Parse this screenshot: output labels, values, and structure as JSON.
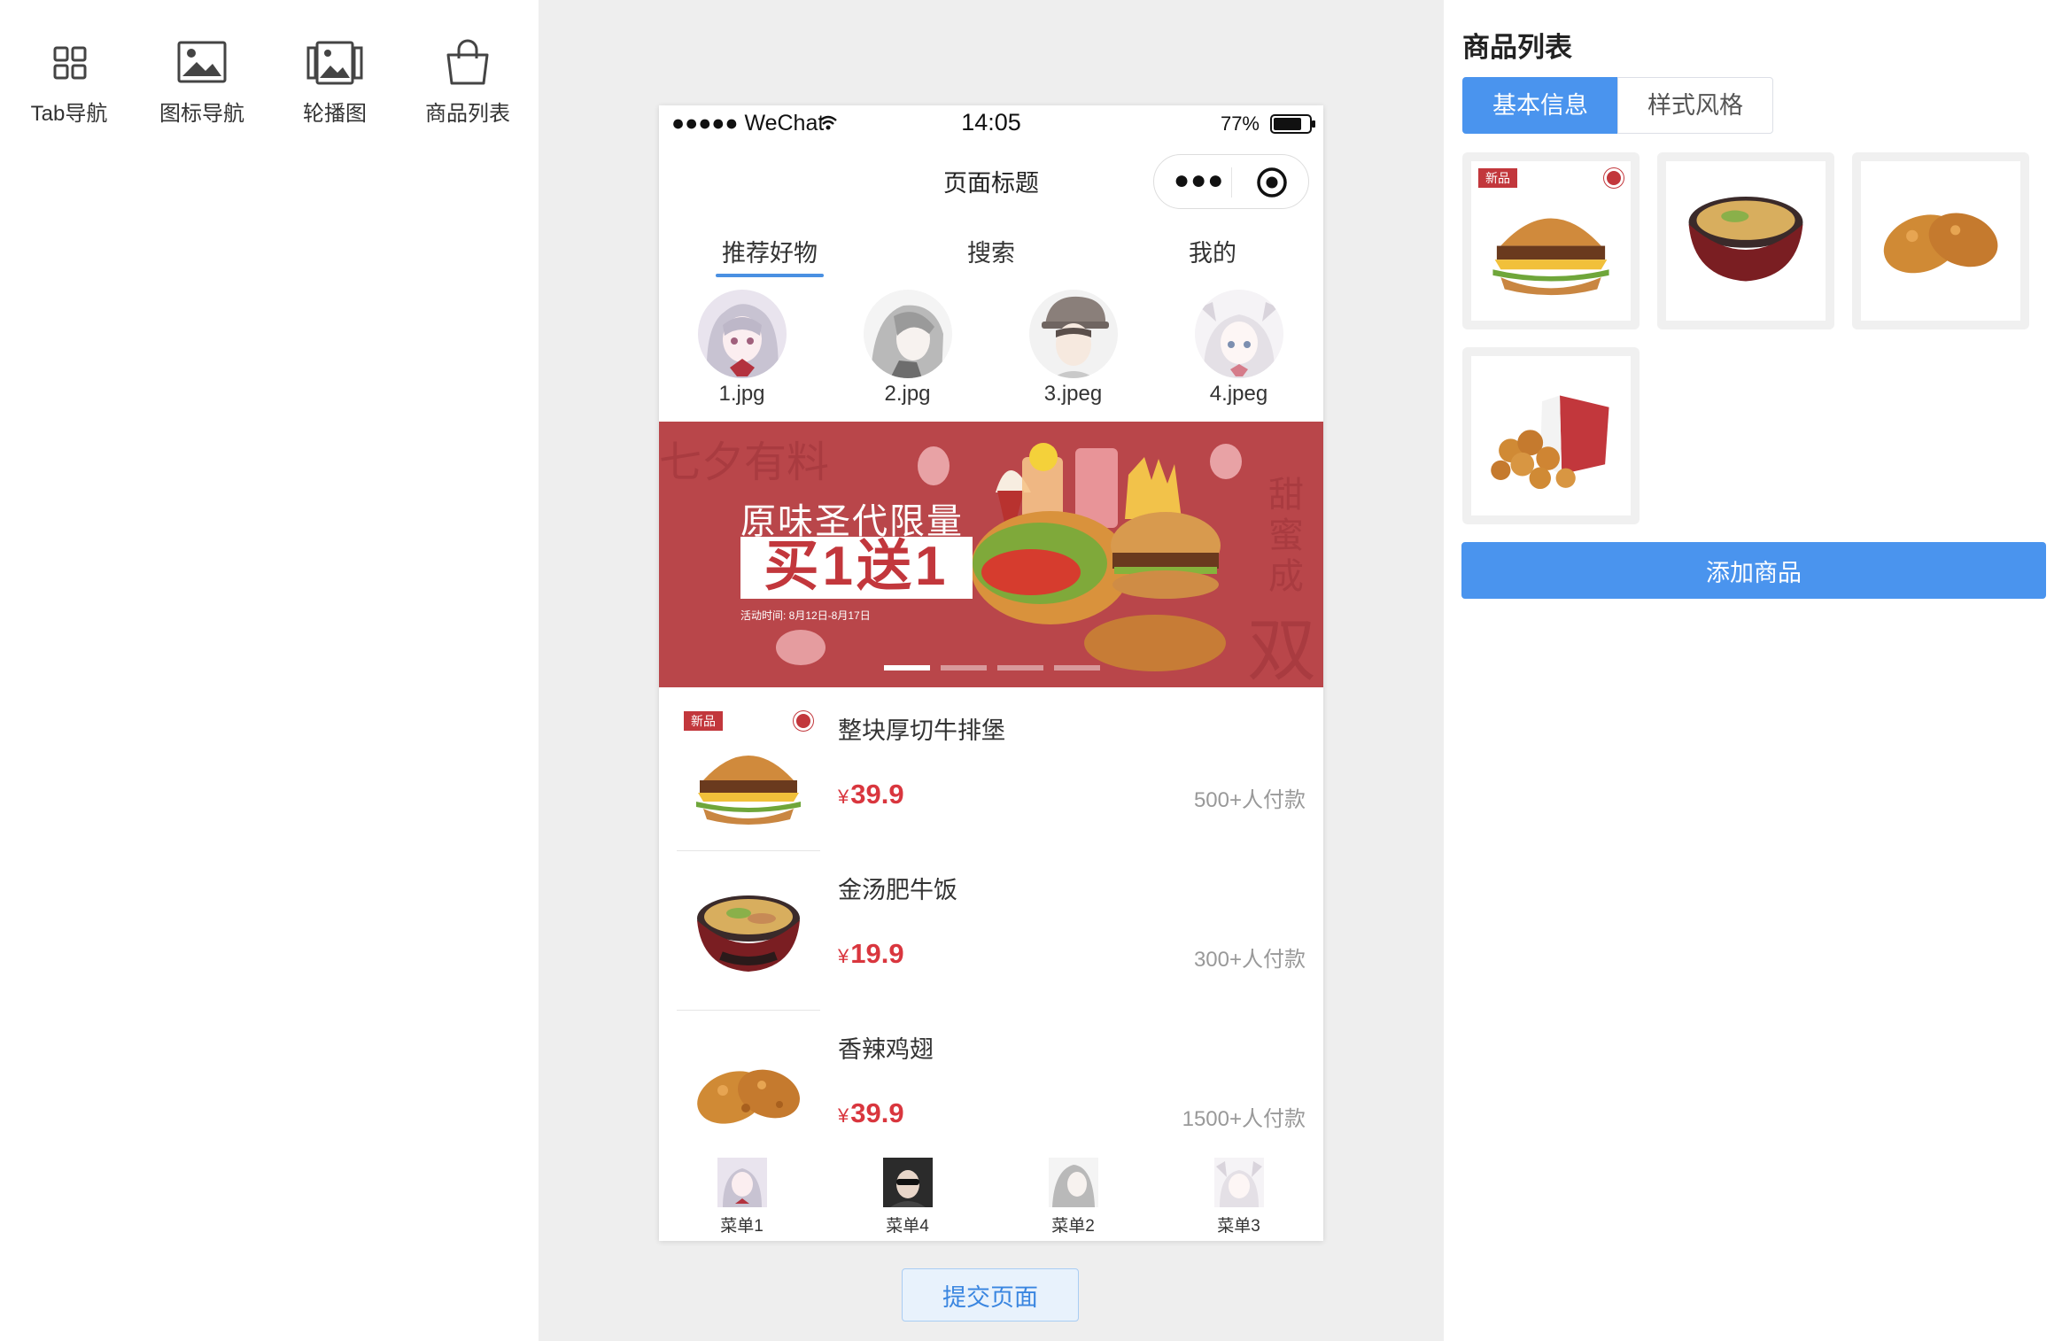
{
  "palette": {
    "items": [
      {
        "label": "Tab导航",
        "icon": "grid-icon"
      },
      {
        "label": "图标导航",
        "icon": "image-icon"
      },
      {
        "label": "轮播图",
        "icon": "gallery-icon"
      },
      {
        "label": "商品列表",
        "icon": "shopping-bag-icon"
      }
    ]
  },
  "phone": {
    "status": {
      "carrier": "●●●●● WeChat",
      "time": "14:05",
      "battery": "77%"
    },
    "page_title": "页面标题",
    "capsule": {
      "menu_icon": "more-dots-icon",
      "close_icon": "target-icon"
    },
    "tabs": [
      {
        "label": "推荐好物",
        "active": true
      },
      {
        "label": "搜索",
        "active": false
      },
      {
        "label": "我的",
        "active": false
      }
    ],
    "icon_nav": [
      {
        "label": "1.jpg"
      },
      {
        "label": "2.jpg"
      },
      {
        "label": "3.jpeg"
      },
      {
        "label": "4.jpeg"
      }
    ],
    "banner": {
      "headline": "原味圣代限量",
      "promo": "买1送1",
      "date": "活动时间: 8月12日-8月17日",
      "deco_top": "七夕有料",
      "deco_right": "甜蜜成",
      "deco_right_big": "双",
      "active_dot": 0,
      "dot_count": 4
    },
    "products": [
      {
        "name": "整块厚切牛排堡",
        "currency": "¥",
        "price": "39.9",
        "sales": "500+人付款",
        "badge": "新品"
      },
      {
        "name": "金汤肥牛饭",
        "currency": "¥",
        "price": "19.9",
        "sales": "300+人付款"
      },
      {
        "name": "香辣鸡翅",
        "currency": "¥",
        "price": "39.9",
        "sales": "1500+人付款"
      }
    ],
    "tabbar": [
      {
        "label": "菜单1"
      },
      {
        "label": "菜单4"
      },
      {
        "label": "菜单2"
      },
      {
        "label": "菜单3"
      }
    ]
  },
  "submit_label": "提交页面",
  "right_panel": {
    "title": "商品列表",
    "segments": [
      {
        "label": "基本信息",
        "active": true
      },
      {
        "label": "样式风格",
        "active": false
      }
    ],
    "badge": "新品",
    "add_label": "添加商品"
  },
  "colors": {
    "accent": "#4a94ee",
    "price": "#d9363e",
    "banner": "#b9464a",
    "canvas_bg": "#eeeeee"
  }
}
